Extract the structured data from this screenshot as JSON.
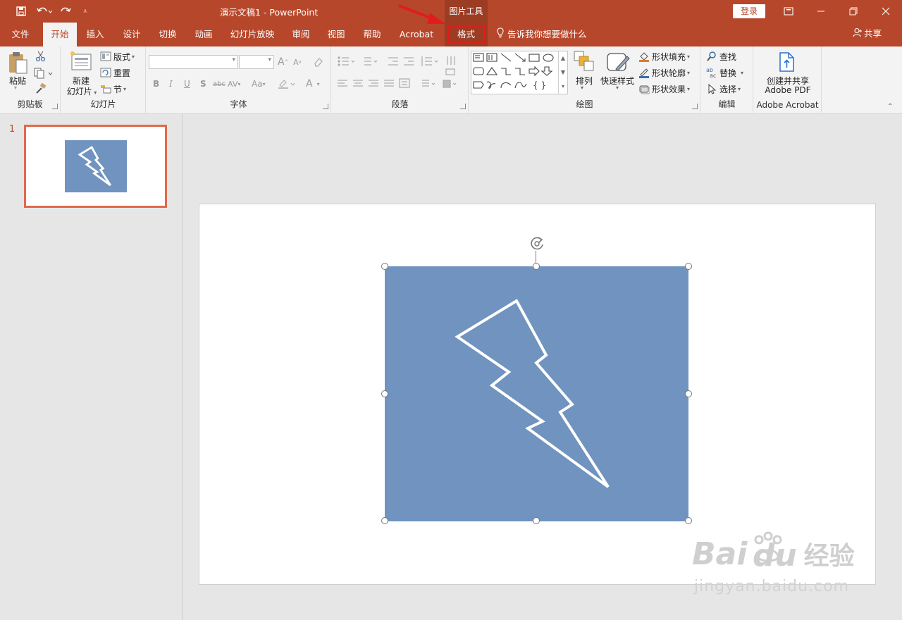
{
  "title_bar": {
    "document_title": "演示文稿1  -  PowerPoint",
    "context_tab_group": "图片工具",
    "login_label": "登录"
  },
  "tabs": [
    {
      "label": "文件",
      "active": false
    },
    {
      "label": "开始",
      "active": true
    },
    {
      "label": "插入",
      "active": false
    },
    {
      "label": "设计",
      "active": false
    },
    {
      "label": "切换",
      "active": false
    },
    {
      "label": "动画",
      "active": false
    },
    {
      "label": "幻灯片放映",
      "active": false
    },
    {
      "label": "审阅",
      "active": false
    },
    {
      "label": "视图",
      "active": false
    },
    {
      "label": "帮助",
      "active": false
    },
    {
      "label": "Acrobat",
      "active": false
    },
    {
      "label": "格式",
      "active": false,
      "highlighted": true
    }
  ],
  "tell_me": "告诉我你想要做什么",
  "share_label": "共享",
  "ribbon": {
    "clipboard": {
      "group_label": "剪贴板",
      "paste_label": "粘贴"
    },
    "slides": {
      "group_label": "幻灯片",
      "new_slide_label_1": "新建",
      "new_slide_label_2": "幻灯片",
      "layout_label": "版式",
      "reset_label": "重置",
      "section_label": "节"
    },
    "font": {
      "group_label": "字体",
      "bold": "B",
      "italic": "I",
      "underline": "U",
      "shadow": "S",
      "strike": "abc",
      "spacing": "AV",
      "case": "Aa",
      "grow": "A",
      "shrink": "A",
      "color": "A"
    },
    "paragraph": {
      "group_label": "段落"
    },
    "drawing": {
      "group_label": "绘图",
      "arrange_label": "排列",
      "quick_styles_label": "快速样式",
      "fill_label": "形状填充",
      "outline_label": "形状轮廓",
      "effects_label": "形状效果",
      "shapes_row3_braces": "{  }"
    },
    "editing": {
      "group_label": "编辑",
      "find_label": "查找",
      "replace_label": "替换",
      "select_label": "选择"
    },
    "acrobat": {
      "group_label": "Adobe Acrobat",
      "create_label_1": "创建并共享",
      "create_label_2": "Adobe PDF"
    }
  },
  "slide_panel": {
    "slide_number": "1"
  },
  "watermark": {
    "brand": "Bai",
    "brand2": "du",
    "cn": "经验",
    "url": "jingyan.baidu.com"
  },
  "colors": {
    "accent": "#b7472a",
    "context_group": "#9c3c23",
    "highlight_box": "#e21c1c",
    "shape_fill": "#7093bf",
    "thumb_border": "#e2694a",
    "arrow": "#e21c1c"
  },
  "icons": [
    "save-icon",
    "undo-icon",
    "redo-icon",
    "customize-icon",
    "restore-icon",
    "minimize-icon",
    "maximize-icon",
    "close-icon",
    "lightbulb-icon",
    "share-user-icon",
    "rotate-icon",
    "lightning-icon"
  ]
}
